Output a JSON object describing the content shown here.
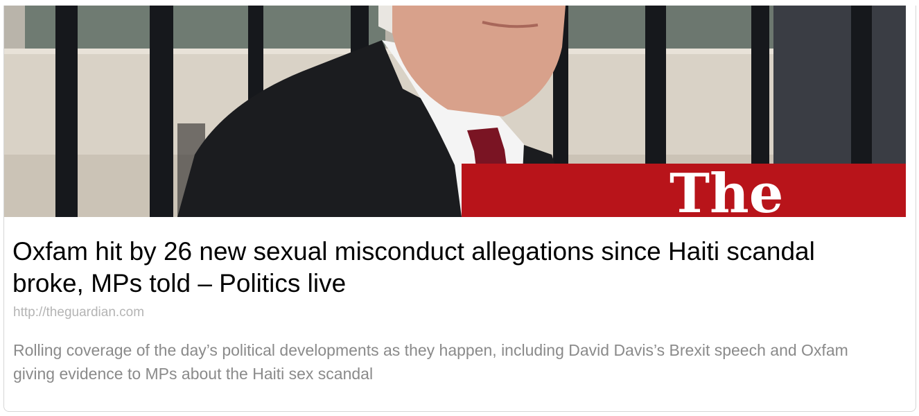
{
  "link_preview": {
    "image": {
      "masthead_text": "The",
      "banner_color": "#b8141a"
    },
    "headline": "Oxfam hit by 26 new sexual misconduct allegations since Haiti scandal broke, MPs told – Politics live",
    "source_url": "http://theguardian.com",
    "description": "Rolling coverage of the day’s political developments as they happen, including David Davis’s Brexit speech and Oxfam giving evidence to MPs about the Haiti sex scandal"
  }
}
